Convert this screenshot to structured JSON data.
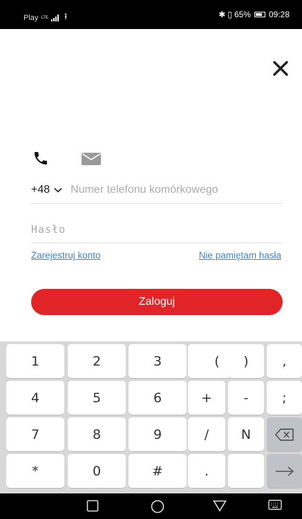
{
  "status_bar": {
    "carrier": "Play",
    "network": "LTE",
    "battery_percent": "65%",
    "time": "09:28"
  },
  "login": {
    "phone_tab_icon": "phone-icon",
    "email_tab_icon": "mail-icon",
    "country_code": "+48",
    "phone_placeholder": "Numer telefonu komórkowego",
    "password_placeholder": "Hasło",
    "register_link": "Zarejestruj konto",
    "forgot_link": "Nie pamiętam hasła",
    "submit_label": "Zaloguj"
  },
  "keypad": {
    "rows": [
      [
        "1",
        "2",
        "3",
        "(",
        ")",
        ","
      ],
      [
        "4",
        "5",
        "6",
        "+",
        "-",
        ";"
      ],
      [
        "7",
        "8",
        "9",
        "/",
        "N",
        ""
      ],
      [
        "*",
        "0",
        "#",
        ".",
        "",
        ""
      ]
    ]
  },
  "colors": {
    "accent": "#e02427",
    "link": "#3a86c8"
  }
}
